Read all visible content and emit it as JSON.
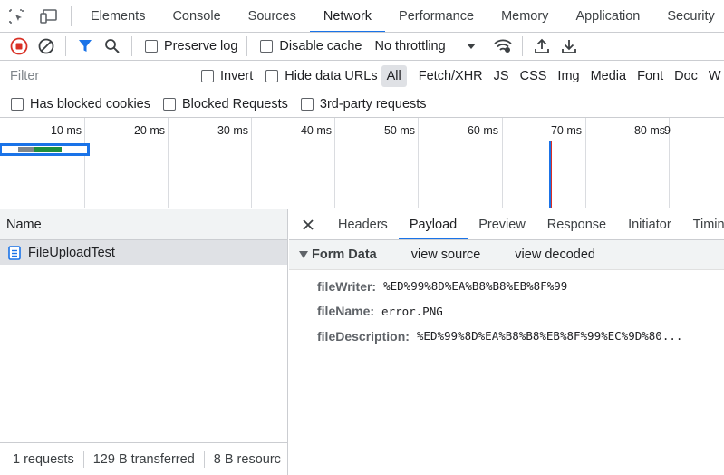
{
  "tabs": [
    "Elements",
    "Console",
    "Sources",
    "Network",
    "Performance",
    "Memory",
    "Application",
    "Security"
  ],
  "toolbar": {
    "preserve_log": "Preserve log",
    "disable_cache": "Disable cache",
    "throttling": "No throttling"
  },
  "filter": {
    "placeholder": "Filter",
    "invert": "Invert",
    "hide_data_urls": "Hide data URLs",
    "types": [
      "All",
      "Fetch/XHR",
      "JS",
      "CSS",
      "Img",
      "Media",
      "Font",
      "Doc",
      "W"
    ]
  },
  "filter2": {
    "blocked_cookies": "Has blocked cookies",
    "blocked_requests": "Blocked Requests",
    "third_party": "3rd-party requests"
  },
  "timeline": {
    "ticks": [
      "10 ms",
      "20 ms",
      "30 ms",
      "40 ms",
      "50 ms",
      "60 ms",
      "70 ms",
      "80 ms",
      "9"
    ]
  },
  "requests": {
    "header": "Name",
    "items": [
      "FileUploadTest"
    ]
  },
  "status": {
    "count": "1 requests",
    "transferred": "129 B transferred",
    "resources": "8 B resourc"
  },
  "detail": {
    "tabs": [
      "Headers",
      "Payload",
      "Preview",
      "Response",
      "Initiator",
      "Timin"
    ],
    "section_title": "Form Data",
    "view_source": "view source",
    "view_decoded": "view decoded",
    "fields": [
      {
        "key": "fileWriter:",
        "value": "%ED%99%8D%EA%B8%B8%EB%8F%99"
      },
      {
        "key": "fileName:",
        "value": "error.PNG"
      },
      {
        "key": "fileDescription:",
        "value": "%ED%99%8D%EA%B8%B8%EB%8F%99%EC%9D%80..."
      }
    ]
  },
  "colors": {
    "accent": "#1a73e8",
    "record_red": "#d93025",
    "bar_green": "#1e8e3e",
    "bar_gray": "#80868b",
    "finish_line": "#9b4d9b"
  }
}
